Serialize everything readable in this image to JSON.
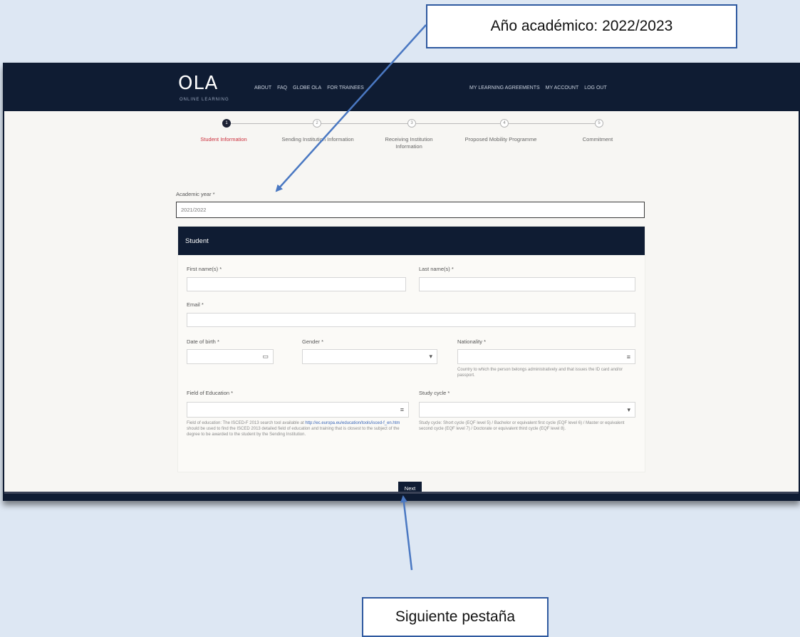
{
  "callouts": {
    "top": "Año académico: 2022/2023",
    "bottom": "Siguiente pestaña"
  },
  "nav": {
    "logo": "OLA",
    "logo_sub": "ONLINE LEARNING",
    "left_links": [
      "ABOUT",
      "FAQ",
      "GLOBE OLA",
      "FOR TRAINEES"
    ],
    "right_links": [
      "MY LEARNING AGREEMENTS",
      "MY ACCOUNT",
      "LOG OUT"
    ]
  },
  "steps": [
    {
      "number": "1",
      "label": "Student Information",
      "active": true
    },
    {
      "number": "2",
      "label": "Sending Institution Information",
      "active": false
    },
    {
      "number": "3",
      "label": "Receiving Institution Information",
      "active": false
    },
    {
      "number": "4",
      "label": "Proposed Mobility Programme",
      "active": false
    },
    {
      "number": "5",
      "label": "Commitment",
      "active": false
    }
  ],
  "form": {
    "academic_year_label": "Academic year *",
    "academic_year_value": "2021/2022",
    "section_title": "Student",
    "first_name_label": "First name(s) *",
    "last_name_label": "Last name(s) *",
    "email_label": "Email *",
    "dob_label": "Date of birth *",
    "gender_label": "Gender *",
    "nationality_label": "Nationality *",
    "nationality_hint": "Country to which the person belongs administratively and that issues the ID card and/or passport.",
    "field_label": "Field of Education *",
    "field_hint_pre": "Field of education: The ISCED-F 2013 search tool available at",
    "field_hint_link": "http://ec.europa.eu/education/tools/isced-f_en.htm",
    "field_hint_post": "should be used to find the ISCED 2013 detailed field of education and training that is closest to the subject of the degree to be awarded to the student by the Sending Institution.",
    "study_cycle_label": "Study cycle *",
    "study_cycle_hint": "Study cycle: Short cycle (EQF level 5) / Bachelor or equivalent first cycle (EQF level 6) / Master or equivalent second cycle (EQF level 7) / Doctorate or equivalent third cycle (EQF level 8)."
  },
  "next_button": "Next",
  "colors": {
    "navy": "#0f1c33",
    "accent_red": "#cc2f3c",
    "arrow_blue": "#4a78c2",
    "callout_border": "#2f5aa0",
    "background": "#dde7f3"
  },
  "icons": {
    "calendar": "calendar-icon",
    "dropdown": "chevron-down-icon",
    "list": "list-icon"
  }
}
